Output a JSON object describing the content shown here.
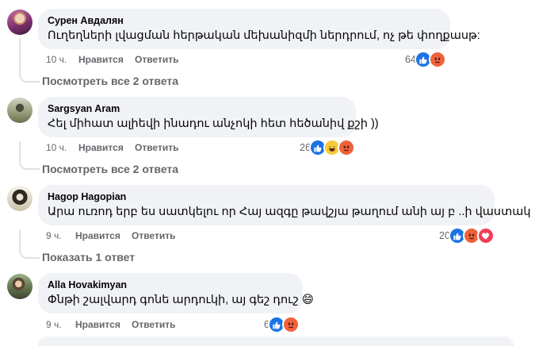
{
  "comments": [
    {
      "author": "Сурен Авдалян",
      "text": "Ուղեղների լվացման հերթական մեխանիզմի ներդրում, ոչ թե փողքասթ:",
      "time": "10 ч.",
      "like_label": "Нравится",
      "reply_label": "Ответить",
      "reaction_count": "64",
      "reactions": [
        "like-icon",
        "angry-icon"
      ],
      "replies_link": "Посмотреть все 2 ответа"
    },
    {
      "author": "Sargsyan Aram",
      "text": "Հել միհատ ալիեվի ինադու անչոկի հետ հեծանիվ քշի ))",
      "time": "10 ч.",
      "like_label": "Нравится",
      "reply_label": "Ответить",
      "reaction_count": "26",
      "reactions": [
        "like-icon",
        "laugh-icon",
        "angry-icon"
      ],
      "replies_link": "Посмотреть все 2 ответа"
    },
    {
      "author": "Hagop Hagopian",
      "text": "Արա ուռոդ երբ ես սատկելու որ Հայ ազգը թավշյա թաղում անի այ բ ..ի վաստակ",
      "time": "9 ч.",
      "like_label": "Нравится",
      "reply_label": "Ответить",
      "reaction_count": "20",
      "reactions": [
        "like-icon",
        "angry-icon",
        "love-icon"
      ],
      "replies_link": "Показать 1 ответ"
    },
    {
      "author": "Alla Hovakimyan",
      "text": "Փնթի շալվարդ գոնե արդուկի, այ գեշ դուշ 😄",
      "time": "9 ч.",
      "like_label": "Нравится",
      "reply_label": "Ответить",
      "reaction_count": "6",
      "reactions": [
        "like-icon",
        "angry-icon"
      ]
    }
  ],
  "colors": {
    "bubble": "#f0f2f5",
    "secondary_text": "#65676b",
    "like_blue": "#1b74e4",
    "angry_orange": "#f0623b",
    "love_red": "#f33e58",
    "laugh_yellow": "#f7c93b"
  }
}
